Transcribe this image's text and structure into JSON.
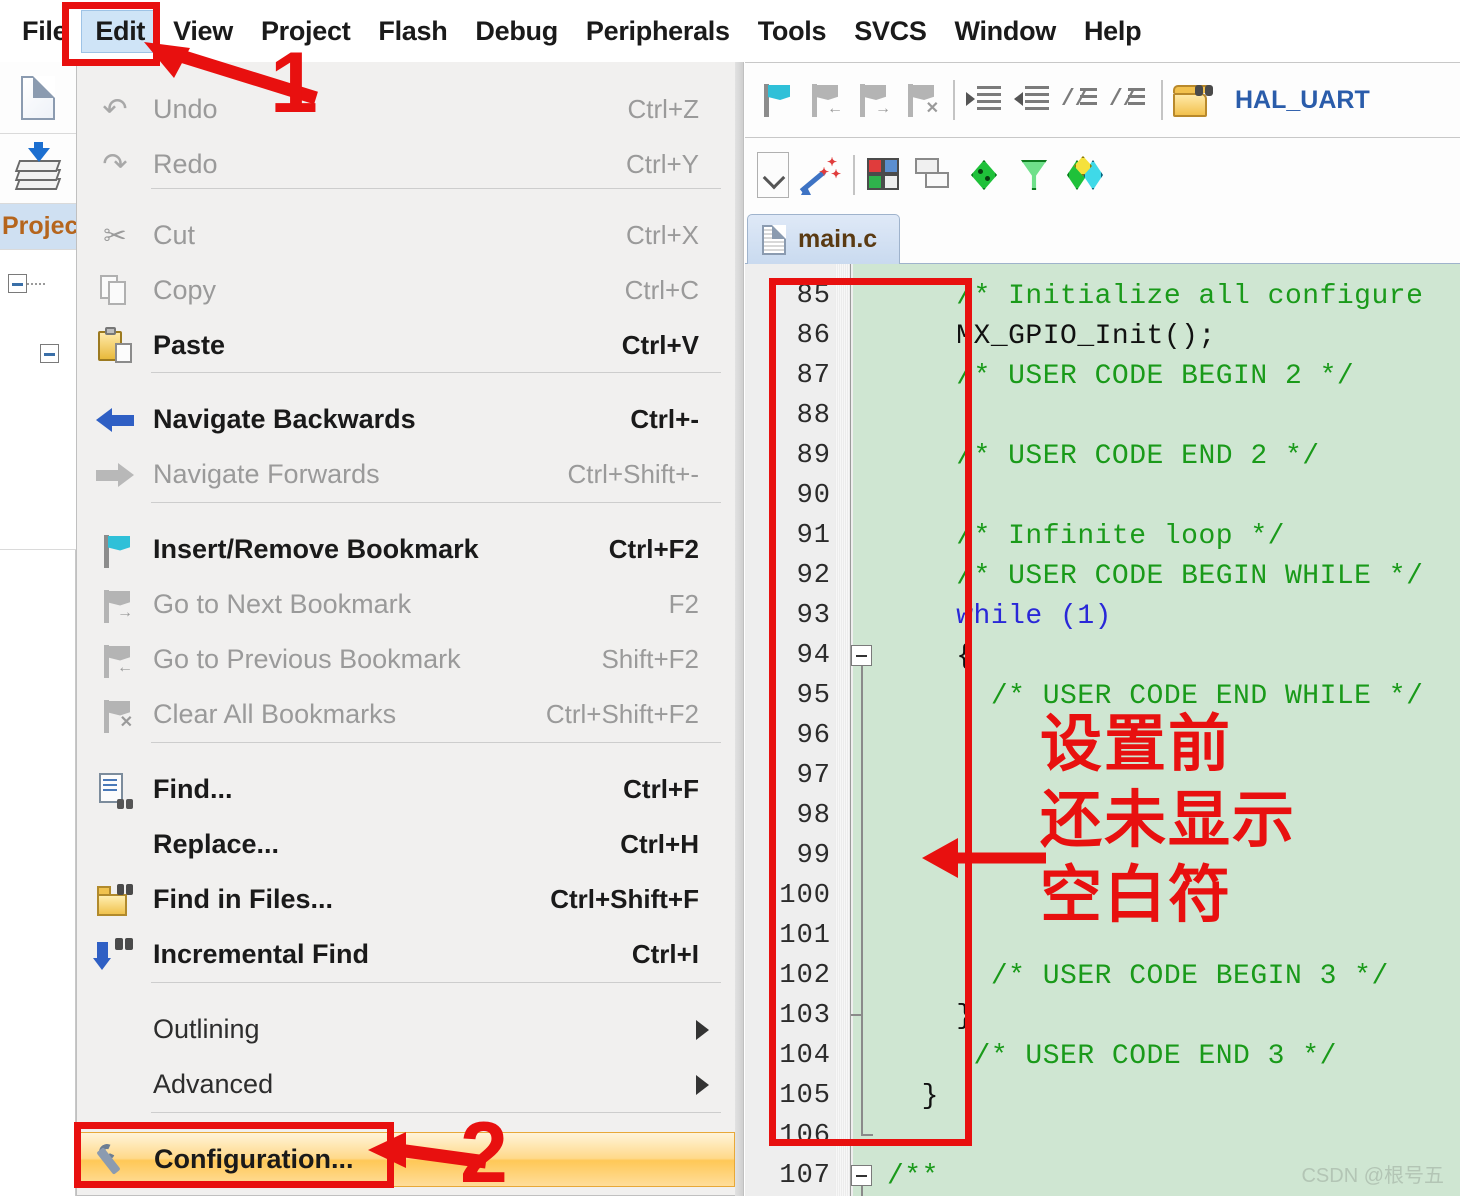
{
  "menubar": {
    "items": [
      {
        "label": "File",
        "active": false
      },
      {
        "label": "Edit",
        "active": true
      },
      {
        "label": "View",
        "active": false
      },
      {
        "label": "Project",
        "active": false
      },
      {
        "label": "Flash",
        "active": false
      },
      {
        "label": "Debug",
        "active": false
      },
      {
        "label": "Peripherals",
        "active": false
      },
      {
        "label": "Tools",
        "active": false
      },
      {
        "label": "SVCS",
        "active": false
      },
      {
        "label": "Window",
        "active": false
      },
      {
        "label": "Help",
        "active": false
      }
    ]
  },
  "left_strip": {
    "new_file_icon": "new-document-icon",
    "save_all_icon": "save-all-icon",
    "project_label": "Projec",
    "tree_icon": "project-tree-icon"
  },
  "toolbar": {
    "row1_icons": [
      "insert-remove-bookmark-icon",
      "go-to-previous-bookmark-icon",
      "go-to-next-bookmark-icon",
      "clear-all-bookmarks-icon",
      "indent-right-icon",
      "indent-left-icon",
      "comment-block-icon",
      "uncomment-block-icon",
      "find-in-files-icon"
    ],
    "row1_label": "HAL_UART",
    "row2_icons": [
      "dropdown-arrow-icon",
      "configure-wizard-icon",
      "build-target-icon",
      "batch-build-icon",
      "options-target-icon",
      "filter-icon",
      "manage-project-items-icon"
    ]
  },
  "editor_tab": {
    "label": "main.c",
    "icon": "source-file-icon"
  },
  "menu": {
    "items": [
      {
        "label": "Undo",
        "accel": "Ctrl+Z",
        "icon": "undo-icon",
        "state": "disabled"
      },
      {
        "label": "Redo",
        "accel": "Ctrl+Y",
        "icon": "redo-icon",
        "state": "disabled"
      },
      {
        "label": "Cut",
        "accel": "Ctrl+X",
        "icon": "scissors-icon",
        "state": "disabled"
      },
      {
        "label": "Copy",
        "accel": "Ctrl+C",
        "icon": "copy-icon",
        "state": "disabled"
      },
      {
        "label": "Paste",
        "accel": "Ctrl+V",
        "icon": "paste-icon",
        "state": "bold"
      },
      {
        "label": "Navigate Backwards",
        "accel": "Ctrl+-",
        "icon": "arrow-left-icon",
        "state": "bold"
      },
      {
        "label": "Navigate Forwards",
        "accel": "Ctrl+Shift+-",
        "icon": "arrow-right-icon",
        "state": "disabled"
      },
      {
        "label": "Insert/Remove Bookmark",
        "accel": "Ctrl+F2",
        "icon": "bookmark-flag-icon",
        "state": "bold"
      },
      {
        "label": "Go to Next Bookmark",
        "accel": "F2",
        "icon": "next-bookmark-icon",
        "state": "disabled"
      },
      {
        "label": "Go to Previous Bookmark",
        "accel": "Shift+F2",
        "icon": "previous-bookmark-icon",
        "state": "disabled"
      },
      {
        "label": "Clear All Bookmarks",
        "accel": "Ctrl+Shift+F2",
        "icon": "clear-bookmarks-icon",
        "state": "disabled"
      },
      {
        "label": "Find...",
        "accel": "Ctrl+F",
        "icon": "find-icon",
        "state": "bold"
      },
      {
        "label": "Replace...",
        "accel": "Ctrl+H",
        "icon": "",
        "state": "bold"
      },
      {
        "label": "Find in Files...",
        "accel": "Ctrl+Shift+F",
        "icon": "find-in-files-icon",
        "state": "bold"
      },
      {
        "label": "Incremental Find",
        "accel": "Ctrl+I",
        "icon": "incremental-find-icon",
        "state": "bold"
      },
      {
        "label": "Outlining",
        "accel": "",
        "icon": "",
        "state": "submenu"
      },
      {
        "label": "Advanced",
        "accel": "",
        "icon": "",
        "state": "submenu"
      },
      {
        "label": "Configuration...",
        "accel": "",
        "icon": "wrench-icon",
        "state": "highlight"
      }
    ]
  },
  "code": {
    "lines": [
      {
        "no": "85",
        "text": "    /* Initialize all configure",
        "kind": "comment",
        "fold": "none"
      },
      {
        "no": "86",
        "text": "    MX_GPIO_Init();",
        "kind": "plain",
        "fold": "none"
      },
      {
        "no": "87",
        "text": "    /* USER CODE BEGIN 2 */",
        "kind": "comment",
        "fold": "none"
      },
      {
        "no": "88",
        "text": "",
        "kind": "plain",
        "fold": "none"
      },
      {
        "no": "89",
        "text": "    /* USER CODE END 2 */",
        "kind": "comment",
        "fold": "none"
      },
      {
        "no": "90",
        "text": "",
        "kind": "plain",
        "fold": "none"
      },
      {
        "no": "91",
        "text": "    /* Infinite loop */",
        "kind": "comment",
        "fold": "none"
      },
      {
        "no": "92",
        "text": "    /* USER CODE BEGIN WHILE */",
        "kind": "comment",
        "fold": "none"
      },
      {
        "no": "93",
        "text": "    while (1)",
        "kind": "kw",
        "fold": "none"
      },
      {
        "no": "94",
        "text": "    {",
        "kind": "plain",
        "fold": "box"
      },
      {
        "no": "95",
        "text": "      /* USER CODE END WHILE */",
        "kind": "comment",
        "fold": "line"
      },
      {
        "no": "96",
        "text": "",
        "kind": "plain",
        "fold": "line"
      },
      {
        "no": "97",
        "text": "",
        "kind": "plain",
        "fold": "line"
      },
      {
        "no": "98",
        "text": "",
        "kind": "plain",
        "fold": "line"
      },
      {
        "no": "99",
        "text": "",
        "kind": "plain",
        "fold": "line"
      },
      {
        "no": "100",
        "text": "",
        "kind": "plain",
        "fold": "line"
      },
      {
        "no": "101",
        "text": "",
        "kind": "plain",
        "fold": "line"
      },
      {
        "no": "102",
        "text": "      /* USER CODE BEGIN 3 */",
        "kind": "comment",
        "fold": "line"
      },
      {
        "no": "103",
        "text": "    }",
        "kind": "plain",
        "fold": "tick"
      },
      {
        "no": "104",
        "text": "     /* USER CODE END 3 */",
        "kind": "comment",
        "fold": "line"
      },
      {
        "no": "105",
        "text": "  }",
        "kind": "plain",
        "fold": "line"
      },
      {
        "no": "106",
        "text": "",
        "kind": "plain",
        "fold": "end"
      },
      {
        "no": "107",
        "text": "/**",
        "kind": "comment",
        "fold": "box"
      }
    ]
  },
  "annotations": {
    "step1_number": "1",
    "step2_number": "2",
    "chinese_note": "设置前\n还未显示\n空白符",
    "chinese_line1": "设置前",
    "chinese_line2": "还未显示",
    "chinese_line3": "空白符",
    "highlight_color": "#e8100f"
  },
  "watermark": {
    "text": "CSDN @根号五"
  }
}
